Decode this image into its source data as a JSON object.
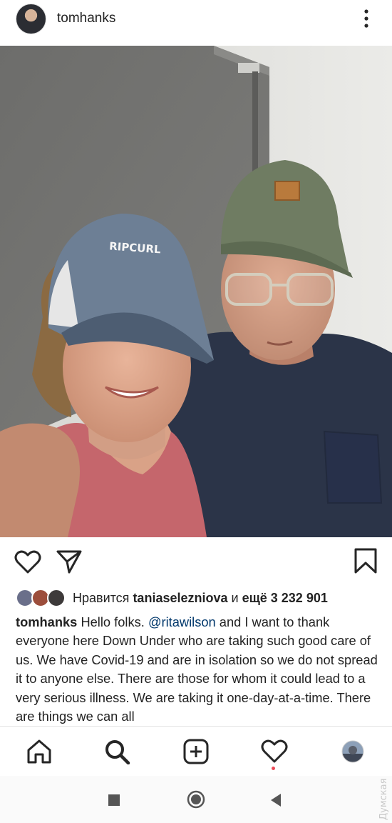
{
  "header": {
    "username": "tomhanks",
    "avatar_icon": "profile-avatar",
    "more_icon": "more-vertical-icon"
  },
  "post": {
    "photo_cap_text": "RIPCURL",
    "actions": {
      "like_icon": "heart-outline-icon",
      "share_icon": "paper-plane-icon",
      "save_icon": "bookmark-outline-icon"
    },
    "likes": {
      "prefix": "Нравится ",
      "liked_by": "taniaselezniova",
      "connector": " и ",
      "others": "ещё 3 232 901"
    },
    "caption": {
      "author": "tomhanks",
      "text_before_mention": " Hello folks. ",
      "mention": "@ritawilson",
      "text_after_mention": " and I want to thank everyone here Down Under who are taking such good care of us. We have Covid-19 and are in isolation so we do not spread it to anyone else. There are those for whom it could lead to a very serious illness. We are taking it one-day-at-a-time. There are things we can all"
    }
  },
  "tabbar": {
    "items": [
      "home-icon",
      "search-icon",
      "new-post-icon",
      "activity-icon",
      "profile-icon"
    ],
    "notification_color": "#ed4956"
  },
  "system_nav": {
    "items": [
      "recents-button",
      "home-button",
      "back-button"
    ]
  },
  "watermark": {
    "text": "Думская"
  },
  "colors": {
    "text": "#262626",
    "mention": "#00376b",
    "background": "#ffffff"
  }
}
